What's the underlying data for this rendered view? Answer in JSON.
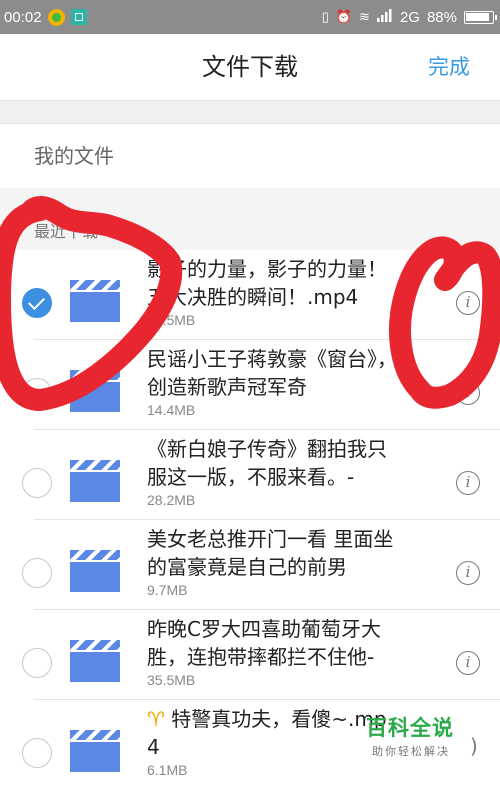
{
  "status_bar": {
    "time": "00:02",
    "network": "2G",
    "battery": "88%"
  },
  "header": {
    "title": "文件下载",
    "done_label": "完成"
  },
  "my_files": {
    "label": "我的文件"
  },
  "section": {
    "label": "最近下载"
  },
  "files": [
    {
      "name": "影子的力量，影子的力量！五大决胜的瞬间！.mp4",
      "size": "35.5MB",
      "checked": true
    },
    {
      "name": "民谣小王子蒋敦豪《窗台》，创造新歌声冠军奇",
      "size": "14.4MB",
      "checked": false
    },
    {
      "name": "《新白娘子传奇》翻拍我只服这一版，不服来看。-",
      "size": "28.2MB",
      "checked": false
    },
    {
      "name": "美女老总推开门一看 里面坐的富豪竟是自己的前男",
      "size": "9.7MB",
      "checked": false
    },
    {
      "name": "昨晚C罗大四喜助葡萄牙大胜，连抱带摔都拦不住他-",
      "size": "35.5MB",
      "checked": false
    },
    {
      "name_prefix": "♈",
      "name": " 特警真功夫，看傻~.mp4",
      "size": "6.1MB",
      "checked": false
    }
  ],
  "watermark": {
    "title": "百科全说",
    "subtitle": "助你轻松解决"
  },
  "colors": {
    "accent": "#3b9be2",
    "check": "#3d8fe0",
    "file_icon": "#5b88e5",
    "status_bar": "#8c8c8c",
    "scribble": "#e8262f",
    "watermark": "#2aaa4a"
  },
  "icons": {
    "status_left": [
      "app-notification-icon",
      "screenshot-icon"
    ],
    "status_right": [
      "vibrate-icon",
      "alarm-icon",
      "wifi-icon",
      "signal-icon",
      "battery-icon"
    ],
    "file": "video-clapperboard-icon",
    "info": "info-icon"
  }
}
